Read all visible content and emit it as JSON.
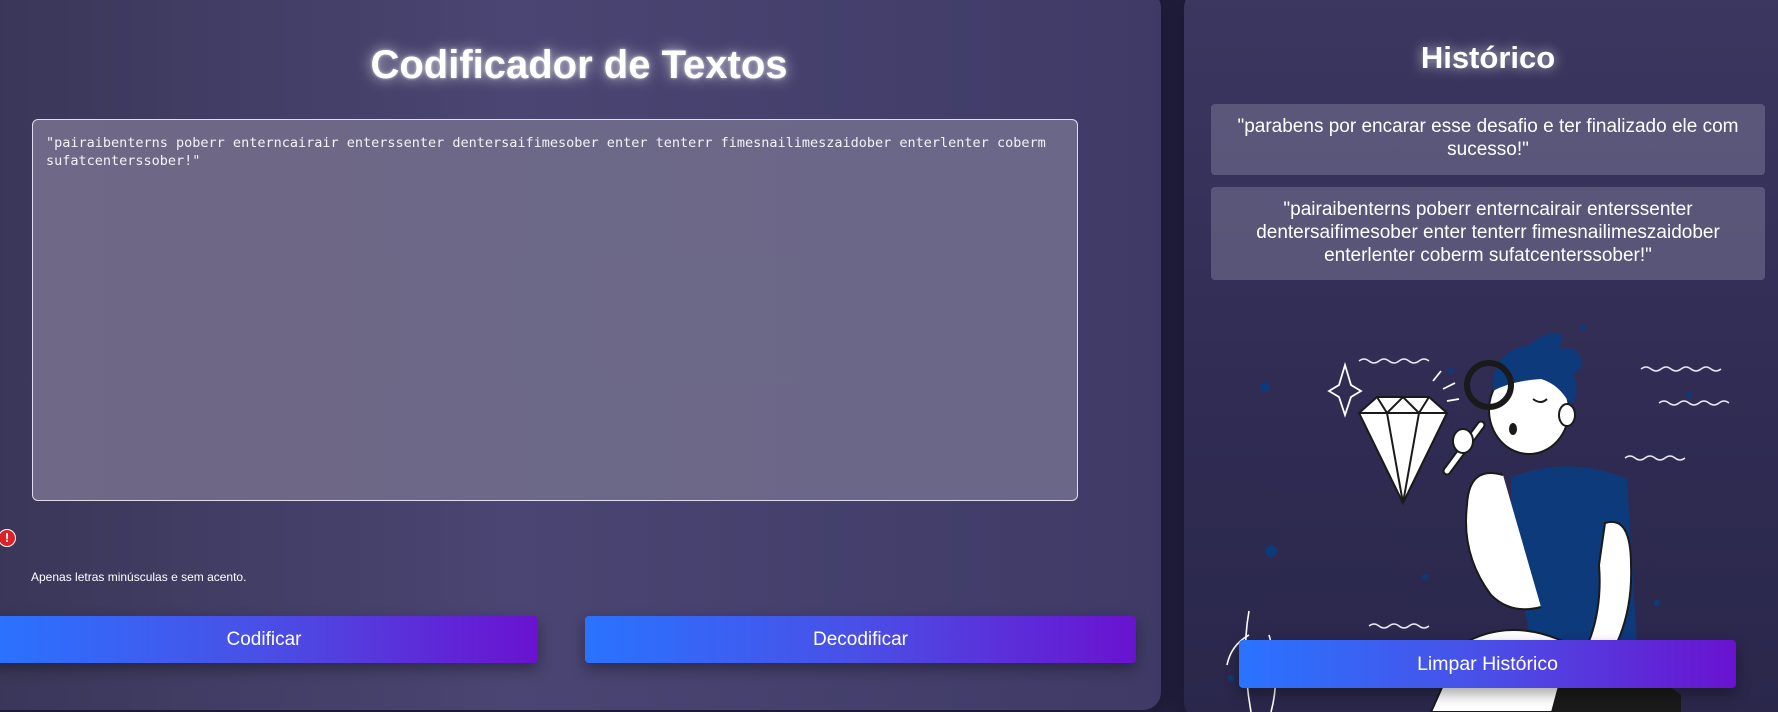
{
  "encoder": {
    "title": "Codificador de Textos",
    "text_value": "\"pairaibenterns poberr enterncairair enterssenter dentersaifimesober enter tenterr fimesnailimeszaidober enterlenter coberm sufatcenterssober!\"",
    "warning_icon": "exclamation-icon",
    "hint": "Apenas letras minúsculas e sem acento.",
    "encode_label": "Codificar",
    "decode_label": "Decodificar"
  },
  "history": {
    "title": "Histórico",
    "items": [
      {
        "text": "\"parabens por encarar esse desafio e ter finalizado ele com sucesso!\""
      },
      {
        "text": "\"pairaibenterns poberr enterncairair enterssenter dentersaifimesober enter tenterr fimesnailimeszaidober enterlenter coberm sufatcenterssober!\""
      }
    ],
    "illustration": "person-with-magnifying-glass-and-diamond-illustration",
    "clear_label": "Limpar Histórico"
  },
  "colors": {
    "button_gradient_start": "#2a73ff",
    "button_gradient_end": "#6a12cf",
    "warning": "#d8232a",
    "figure_blue": "#0d3a7a"
  }
}
